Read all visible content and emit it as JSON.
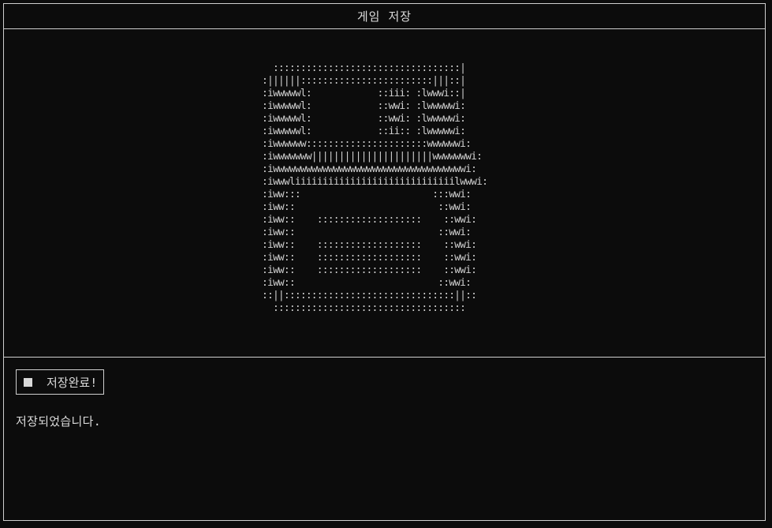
{
  "window": {
    "title": "게임 저장"
  },
  "art": {
    "icon": "floppy-disk-ascii-art",
    "lines": [
      "  ::::::::::::::::::::::::::::::::::|",
      ":||||||::::::::::::::::::::::::|||::|",
      ":iwwwwwl:            ::iii: :lwwwi::|",
      ":iwwwwwl:            ::wwi: :lwwwwwi:",
      ":iwwwwwl:            ::wwi: :lwwwwwi:",
      ":iwwwwwl:            ::ii:: :lwwwwwi:",
      ":iwwwwww::::::::::::::::::::::wwwwwwi:",
      ":iwwwwwww||||||||||||||||||||||wwwwwwwi:",
      ":iwwwwwwwwwwwwwwwwwwwwwwwwwwwwwwwwwwwi:",
      ":iwwwliiiiiiiiiiiiiiiiiiiiiiiiiiiiilwwwi:",
      ":iww:::                        :::wwi:",
      ":iww::                          ::wwi:",
      ":iww::    :::::::::::::::::::    ::wwi:",
      ":iww::                          ::wwi:",
      ":iww::    :::::::::::::::::::    ::wwi:",
      ":iww::    :::::::::::::::::::    ::wwi:",
      ":iww::    :::::::::::::::::::    ::wwi:",
      ":iww::                          ::wwi:",
      "::||:::::::::::::::::::::::::::::::||::",
      "  :::::::::::::::::::::::::::::::::::"
    ]
  },
  "status": {
    "badge_label": "저장완료!",
    "message": "저장되었습니다."
  },
  "colors": {
    "background": "#0c0c0c",
    "foreground": "#d6d6d6",
    "border": "#cfcfcf"
  }
}
